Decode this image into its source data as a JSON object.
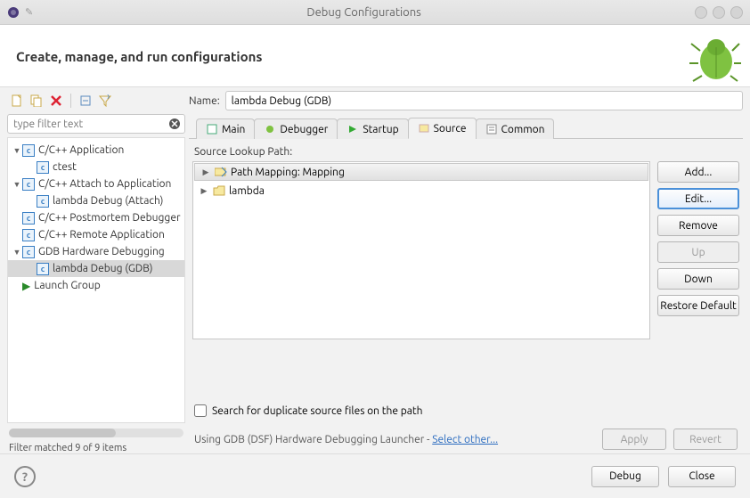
{
  "window": {
    "title": "Debug Configurations"
  },
  "header": {
    "title": "Create, manage, and run configurations"
  },
  "filter": {
    "placeholder": "type filter text",
    "status": "Filter matched 9 of 9 items"
  },
  "tree": [
    {
      "label": "C/C++ Application",
      "expanded": true,
      "icon": "c",
      "children": [
        {
          "label": "ctest",
          "icon": "c"
        }
      ]
    },
    {
      "label": "C/C++ Attach to Application",
      "expanded": true,
      "icon": "c",
      "children": [
        {
          "label": "lambda Debug (Attach)",
          "icon": "c"
        }
      ]
    },
    {
      "label": "C/C++ Postmortem Debugger",
      "icon": "c"
    },
    {
      "label": "C/C++ Remote Application",
      "icon": "c"
    },
    {
      "label": "GDB Hardware Debugging",
      "expanded": true,
      "icon": "c",
      "children": [
        {
          "label": "lambda Debug (GDB)",
          "icon": "c",
          "selected": true
        }
      ]
    },
    {
      "label": "Launch Group",
      "icon": "launch"
    }
  ],
  "name": {
    "label": "Name:",
    "value": "lambda Debug (GDB)"
  },
  "tabs": {
    "items": [
      "Main",
      "Debugger",
      "Startup",
      "Source",
      "Common"
    ],
    "active": 3
  },
  "source_panel": {
    "title": "Source Lookup Path:",
    "rows": [
      {
        "label": "Path Mapping: Mapping",
        "icon": "map",
        "selected": true
      },
      {
        "label": "lambda",
        "icon": "folder"
      }
    ],
    "buttons": {
      "add": "Add...",
      "edit": "Edit...",
      "remove": "Remove",
      "up": "Up",
      "down": "Down",
      "restore": "Restore Default"
    },
    "checkbox": "Search for duplicate source files on the path"
  },
  "launcher": {
    "text": "Using GDB (DSF) Hardware Debugging Launcher - ",
    "link": "Select other...",
    "apply": "Apply",
    "revert": "Revert"
  },
  "footer": {
    "debug": "Debug",
    "close": "Close"
  }
}
